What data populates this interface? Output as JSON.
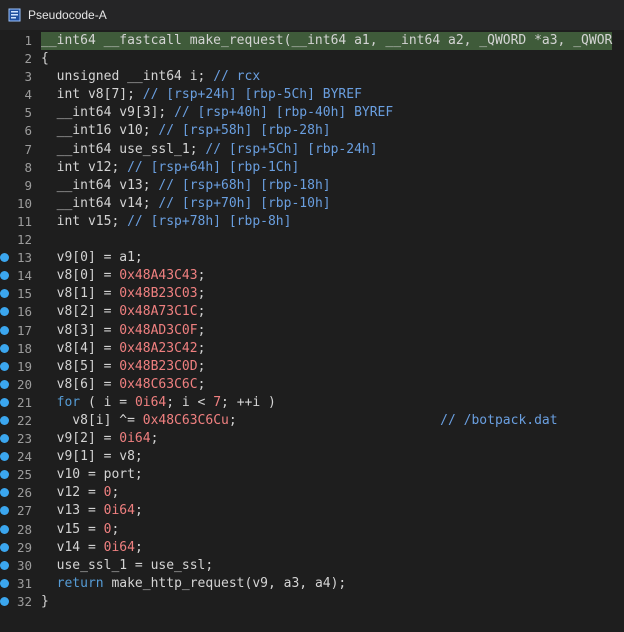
{
  "window": {
    "title": "Pseudocode-A",
    "icon": "pseudocode-window-icon"
  },
  "lines": [
    {
      "n": "1",
      "bp": false,
      "hl": true,
      "segs": [
        {
          "t": "__int64 __fastcall make_request(__int64 a1, __int64 a2, _QWORD *a3, _QWOR",
          "c": "p"
        }
      ]
    },
    {
      "n": "2",
      "bp": false,
      "segs": [
        {
          "t": "{",
          "c": "p"
        }
      ]
    },
    {
      "n": "3",
      "bp": false,
      "segs": [
        {
          "t": "  unsigned __int64 i; ",
          "c": "p"
        },
        {
          "t": "// rcx",
          "c": "c"
        }
      ]
    },
    {
      "n": "4",
      "bp": false,
      "segs": [
        {
          "t": "  int v8[7]; ",
          "c": "p"
        },
        {
          "t": "// [rsp+24h] [rbp-5Ch] BYREF",
          "c": "c"
        }
      ]
    },
    {
      "n": "5",
      "bp": false,
      "segs": [
        {
          "t": "  __int64 v9[3]; ",
          "c": "p"
        },
        {
          "t": "// [rsp+40h] [rbp-40h] BYREF",
          "c": "c"
        }
      ]
    },
    {
      "n": "6",
      "bp": false,
      "segs": [
        {
          "t": "  __int16 v10; ",
          "c": "p"
        },
        {
          "t": "// [rsp+58h] [rbp-28h]",
          "c": "c"
        }
      ]
    },
    {
      "n": "7",
      "bp": false,
      "segs": [
        {
          "t": "  __int64 use_ssl_1; ",
          "c": "p"
        },
        {
          "t": "// [rsp+5Ch] [rbp-24h]",
          "c": "c"
        }
      ]
    },
    {
      "n": "8",
      "bp": false,
      "segs": [
        {
          "t": "  int v12; ",
          "c": "p"
        },
        {
          "t": "// [rsp+64h] [rbp-1Ch]",
          "c": "c"
        }
      ]
    },
    {
      "n": "9",
      "bp": false,
      "segs": [
        {
          "t": "  __int64 v13; ",
          "c": "p"
        },
        {
          "t": "// [rsp+68h] [rbp-18h]",
          "c": "c"
        }
      ]
    },
    {
      "n": "10",
      "bp": false,
      "segs": [
        {
          "t": "  __int64 v14; ",
          "c": "p"
        },
        {
          "t": "// [rsp+70h] [rbp-10h]",
          "c": "c"
        }
      ]
    },
    {
      "n": "11",
      "bp": false,
      "segs": [
        {
          "t": "  int v15; ",
          "c": "p"
        },
        {
          "t": "// [rsp+78h] [rbp-8h]",
          "c": "c"
        }
      ]
    },
    {
      "n": "12",
      "bp": false,
      "segs": [
        {
          "t": "",
          "c": "p"
        }
      ]
    },
    {
      "n": "13",
      "bp": true,
      "segs": [
        {
          "t": "  v9[0] = a1;",
          "c": "p"
        }
      ]
    },
    {
      "n": "14",
      "bp": true,
      "segs": [
        {
          "t": "  v8[0] = ",
          "c": "p"
        },
        {
          "t": "0x48A43C43",
          "c": "n"
        },
        {
          "t": ";",
          "c": "p"
        }
      ]
    },
    {
      "n": "15",
      "bp": true,
      "segs": [
        {
          "t": "  v8[1] = ",
          "c": "p"
        },
        {
          "t": "0x48B23C03",
          "c": "n"
        },
        {
          "t": ";",
          "c": "p"
        }
      ]
    },
    {
      "n": "16",
      "bp": true,
      "segs": [
        {
          "t": "  v8[2] = ",
          "c": "p"
        },
        {
          "t": "0x48A73C1C",
          "c": "n"
        },
        {
          "t": ";",
          "c": "p"
        }
      ]
    },
    {
      "n": "17",
      "bp": true,
      "segs": [
        {
          "t": "  v8[3] = ",
          "c": "p"
        },
        {
          "t": "0x48AD3C0F",
          "c": "n"
        },
        {
          "t": ";",
          "c": "p"
        }
      ]
    },
    {
      "n": "18",
      "bp": true,
      "segs": [
        {
          "t": "  v8[4] = ",
          "c": "p"
        },
        {
          "t": "0x48A23C42",
          "c": "n"
        },
        {
          "t": ";",
          "c": "p"
        }
      ]
    },
    {
      "n": "19",
      "bp": true,
      "segs": [
        {
          "t": "  v8[5] = ",
          "c": "p"
        },
        {
          "t": "0x48B23C0D",
          "c": "n"
        },
        {
          "t": ";",
          "c": "p"
        }
      ]
    },
    {
      "n": "20",
      "bp": true,
      "segs": [
        {
          "t": "  v8[6] = ",
          "c": "p"
        },
        {
          "t": "0x48C63C6C",
          "c": "n"
        },
        {
          "t": ";",
          "c": "p"
        }
      ]
    },
    {
      "n": "21",
      "bp": true,
      "segs": [
        {
          "t": "  ",
          "c": "p"
        },
        {
          "t": "for",
          "c": "k"
        },
        {
          "t": " ( i = ",
          "c": "p"
        },
        {
          "t": "0i64",
          "c": "n"
        },
        {
          "t": "; i < ",
          "c": "p"
        },
        {
          "t": "7",
          "c": "n"
        },
        {
          "t": "; ++i )",
          "c": "p"
        }
      ]
    },
    {
      "n": "22",
      "bp": true,
      "segs": [
        {
          "t": "    v8[i] ^= ",
          "c": "p"
        },
        {
          "t": "0x48C63C6Cu",
          "c": "n"
        },
        {
          "t": ";                          ",
          "c": "p"
        },
        {
          "t": "// /botpack.dat",
          "c": "c"
        }
      ]
    },
    {
      "n": "23",
      "bp": true,
      "segs": [
        {
          "t": "  v9[2] = ",
          "c": "p"
        },
        {
          "t": "0i64",
          "c": "n"
        },
        {
          "t": ";",
          "c": "p"
        }
      ]
    },
    {
      "n": "24",
      "bp": true,
      "segs": [
        {
          "t": "  v9[1] = v8;",
          "c": "p"
        }
      ]
    },
    {
      "n": "25",
      "bp": true,
      "segs": [
        {
          "t": "  v10 = port;",
          "c": "p"
        }
      ]
    },
    {
      "n": "26",
      "bp": true,
      "segs": [
        {
          "t": "  v12 = ",
          "c": "p"
        },
        {
          "t": "0",
          "c": "n"
        },
        {
          "t": ";",
          "c": "p"
        }
      ]
    },
    {
      "n": "27",
      "bp": true,
      "segs": [
        {
          "t": "  v13 = ",
          "c": "p"
        },
        {
          "t": "0i64",
          "c": "n"
        },
        {
          "t": ";",
          "c": "p"
        }
      ]
    },
    {
      "n": "28",
      "bp": true,
      "segs": [
        {
          "t": "  v15 = ",
          "c": "p"
        },
        {
          "t": "0",
          "c": "n"
        },
        {
          "t": ";",
          "c": "p"
        }
      ]
    },
    {
      "n": "29",
      "bp": true,
      "segs": [
        {
          "t": "  v14 = ",
          "c": "p"
        },
        {
          "t": "0i64",
          "c": "n"
        },
        {
          "t": ";",
          "c": "p"
        }
      ]
    },
    {
      "n": "30",
      "bp": true,
      "segs": [
        {
          "t": "  use_ssl_1 = use_ssl;",
          "c": "p"
        }
      ]
    },
    {
      "n": "31",
      "bp": true,
      "segs": [
        {
          "t": "  ",
          "c": "p"
        },
        {
          "t": "return",
          "c": "k"
        },
        {
          "t": " make_http_request(v9, a3, a4);",
          "c": "p"
        }
      ]
    },
    {
      "n": "32",
      "bp": true,
      "segs": [
        {
          "t": "}",
          "c": "p"
        }
      ]
    }
  ],
  "colors": {
    "background": "#1e1e1e",
    "plain": "#d4d4d4",
    "keyword": "#569cd6",
    "number": "#f08080",
    "comment": "#6a9fe0",
    "line_number": "#9c9c9c",
    "breakpoint": "#3ba6ee",
    "highlight": "#3f5b3a"
  }
}
